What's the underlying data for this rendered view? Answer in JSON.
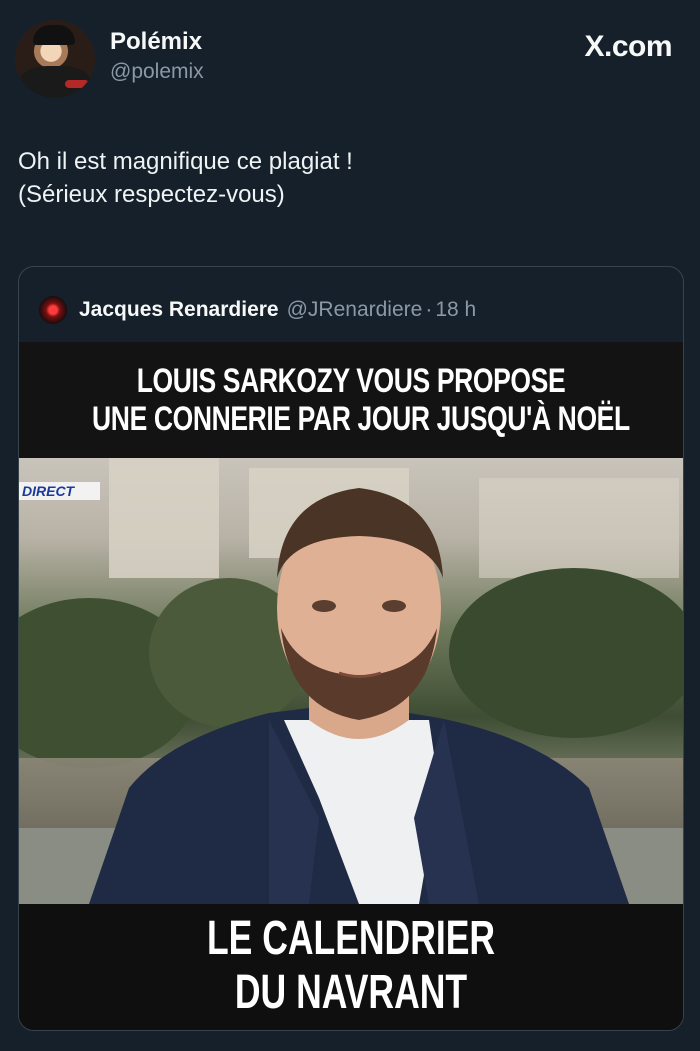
{
  "author": {
    "name": "Polémix",
    "handle": "@polemix"
  },
  "site_label": "X.com",
  "tweet": {
    "lines": [
      "Oh il est magnifique ce plagiat !",
      "(Sérieux respectez-vous)"
    ]
  },
  "quoted": {
    "name": "Jacques Renardiere",
    "handle": "@JRenardiere",
    "separator": "·",
    "time": "18 h",
    "image": {
      "top_caption": [
        "LOUIS SARKOZY VOUS PROPOSE",
        "UNE CONNERIE PAR JOUR JUSQU'À NOËL"
      ],
      "badge": "DIRECT",
      "bottom_caption": [
        "LE CALENDRIER",
        "DU NAVRANT"
      ]
    }
  },
  "colors": {
    "background": "#15202b",
    "text_primary": "#f7f9f9",
    "text_secondary": "#8b98a5",
    "border": "#38444d"
  },
  "icons": {
    "author_avatar": "avatar-photo",
    "quoted_avatar": "red-light-avatar"
  }
}
